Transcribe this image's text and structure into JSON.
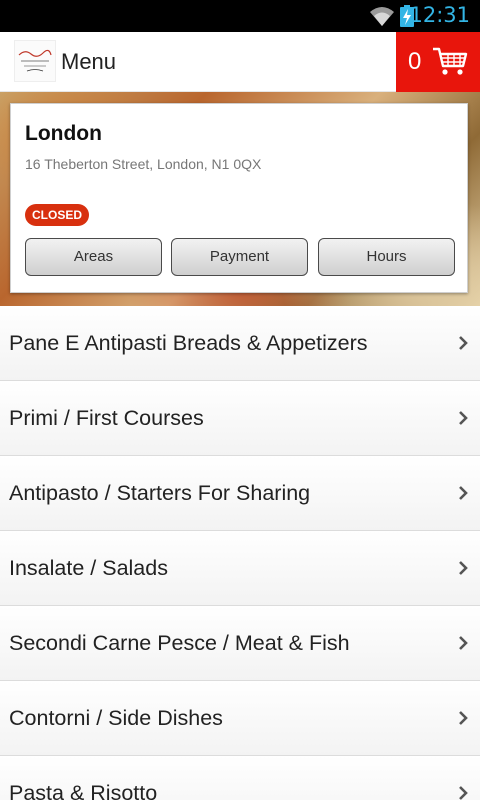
{
  "status_bar": {
    "time": "12:31"
  },
  "header": {
    "title": "Menu",
    "cart_count": "0"
  },
  "restaurant": {
    "location": "London",
    "address": "16 Theberton Street, London, N1 0QX",
    "status": "CLOSED"
  },
  "buttons": {
    "areas": "Areas",
    "payment": "Payment",
    "hours": "Hours"
  },
  "categories": [
    {
      "label": "Pane E Antipasti Breads & Appetizers"
    },
    {
      "label": "Primi / First Courses"
    },
    {
      "label": "Antipasto / Starters For Sharing"
    },
    {
      "label": "Insalate / Salads"
    },
    {
      "label": "Secondi Carne Pesce / Meat & Fish"
    },
    {
      "label": "Contorni / Side Dishes"
    },
    {
      "label": "Pasta & Risotto"
    }
  ],
  "colors": {
    "accent": "#e8150c",
    "clock": "#33b5e5",
    "closed_badge": "#d8300e"
  }
}
